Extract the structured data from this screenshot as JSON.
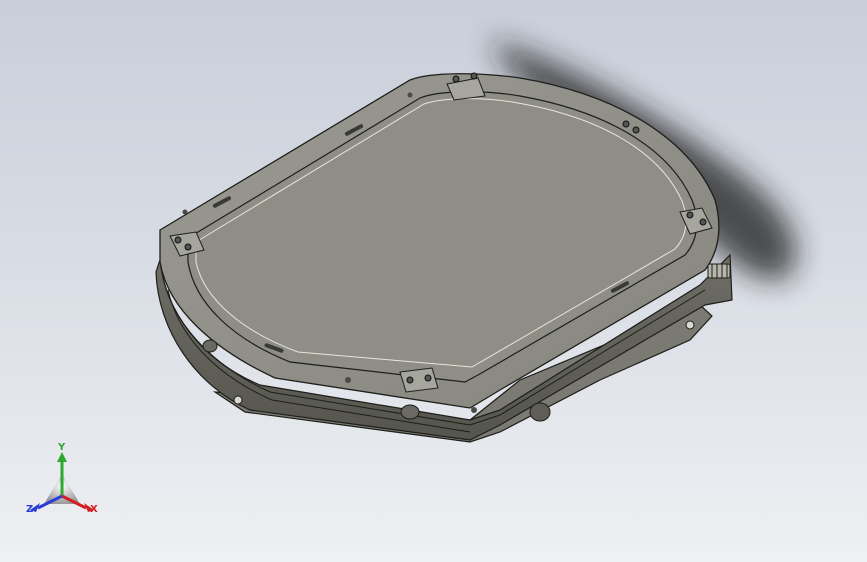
{
  "viewport": {
    "background_top": "#c9ced9",
    "background_bottom": "#eef0f3",
    "model_color": "#8a8a80",
    "plate_color": "#909088",
    "edge_color": "#1e1e1a"
  },
  "triad": {
    "x_label": "X",
    "y_label": "Y",
    "z_label": "Z",
    "x_color": "#d21e1e",
    "y_color": "#2ea82e",
    "z_color": "#2a3ed6"
  }
}
